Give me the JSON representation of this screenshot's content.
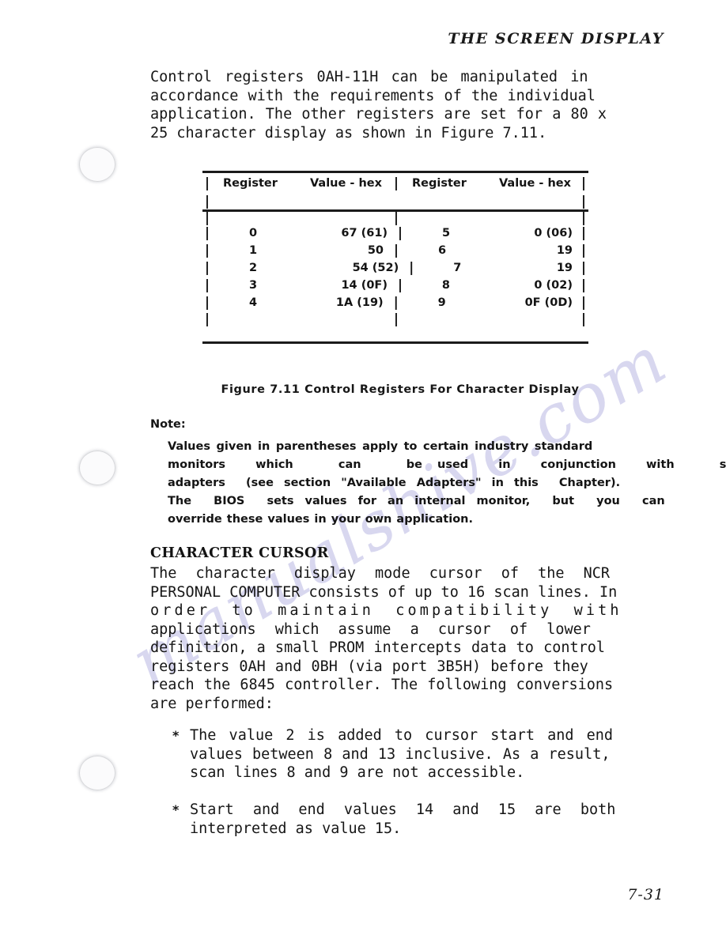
{
  "page": {
    "running_head": "THE SCREEN DISPLAY",
    "page_number": "7-31",
    "watermark": "manualshive.com",
    "colors": {
      "ink": "#161616",
      "watermark": "#b9b8e3",
      "rule": "#1b1b1b",
      "hole_punch": "#d6d7da"
    }
  },
  "intro_paragraph": {
    "lines": [
      "Control registers 0AH-11H can be manipulated in",
      "accordance with the requirements of the individual",
      "application. The other registers are set for a 80 x",
      "25 character display as shown in Figure 7.11."
    ]
  },
  "table": {
    "headers": [
      "Register",
      "Value - hex",
      "Register",
      "Value - hex"
    ],
    "pipe": "|",
    "rows": [
      {
        "reg_left": "0",
        "val_left": "67 (61)",
        "reg_right": "5",
        "val_right": "0 (06)"
      },
      {
        "reg_left": "1",
        "val_left": "50",
        "reg_right": "6",
        "val_right": "19"
      },
      {
        "reg_left": "2",
        "val_left": "54 (52)",
        "reg_right": "7",
        "val_right": "19"
      },
      {
        "reg_left": "3",
        "val_left": "14 (0F)",
        "reg_right": "8",
        "val_right": "0 (02)"
      },
      {
        "reg_left": "4",
        "val_left": "1A (19)",
        "reg_right": "9",
        "val_right": "0F (0D)"
      }
    ]
  },
  "figure_caption": "Figure 7.11  Control Registers For Character Display",
  "note": {
    "label": "Note:",
    "lines": [
      "Values given in parentheses apply to certain industry standard",
      "monitors  which   can   be used  in  conjunction  with   suitable",
      "adapters  (see section \"Available Adapters\" in this  Chapter).",
      "The  BIOS  sets values for an internal monitor,  but  you  can",
      "override these values in your own application."
    ]
  },
  "section": {
    "heading": "CHARACTER CURSOR",
    "paragraph_lines": [
      "The character display mode cursor of the NCR",
      "PERSONAL COMPUTER consists of up to 16 scan lines. In",
      "order to maintain compatibility with",
      "applications which assume a cursor of lower",
      "definition, a small PROM intercepts data to control",
      "registers 0AH and 0BH (via port 3B5H) before they",
      "reach the 6845 controller. The following conversions",
      "are performed:"
    ]
  },
  "bullets": [
    {
      "glyph": "*",
      "lines": [
        "The value 2 is added to cursor start and end",
        "values between 8 and 13 inclusive. As a result,",
        "scan lines 8 and 9 are not accessible."
      ]
    },
    {
      "glyph": "*",
      "lines": [
        "Start and end values 14 and 15 are both",
        "interpreted as value 15."
      ]
    }
  ]
}
